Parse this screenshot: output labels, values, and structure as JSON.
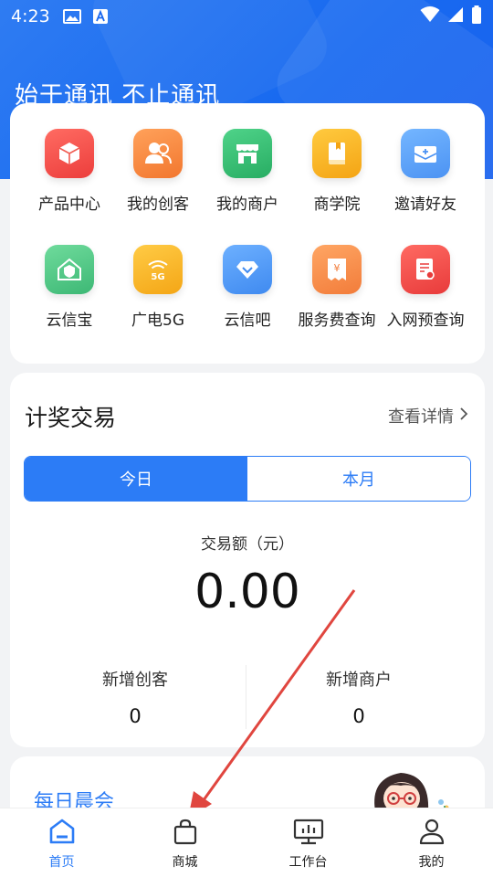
{
  "status_bar": {
    "time": "4:23"
  },
  "hero": {
    "slogan": "始于通讯 不止通讯"
  },
  "quick_menu": {
    "items": [
      {
        "label": "产品中心",
        "icon": "cube-icon",
        "color": "#f2544c"
      },
      {
        "label": "我的创客",
        "icon": "people-icon",
        "color": "#f58a40"
      },
      {
        "label": "我的商户",
        "icon": "store-icon",
        "color": "#35bc75"
      },
      {
        "label": "商学院",
        "icon": "book-icon",
        "color": "#f7b322"
      },
      {
        "label": "邀请好友",
        "icon": "mail-invite-icon",
        "color": "#5aa2f5"
      },
      {
        "label": "云信宝",
        "icon": "house-shield-icon",
        "color": "#54c98a"
      },
      {
        "label": "广电5G",
        "icon": "wifi-5g-icon",
        "color": "#f8b826"
      },
      {
        "label": "云信吧",
        "icon": "diamond-icon",
        "color": "#4a9af4"
      },
      {
        "label": "服务费查询",
        "icon": "receipt-yen-icon",
        "color": "#f78a46"
      },
      {
        "label": "入网预查询",
        "icon": "doc-search-icon",
        "color": "#f04e4e"
      }
    ]
  },
  "reward": {
    "title": "计奖交易",
    "detail_link": "查看详情",
    "tabs": {
      "today": "今日",
      "month": "本月"
    },
    "amount_label": "交易额（元）",
    "amount_value": "0.00",
    "stats": {
      "new_makers_label": "新增创客",
      "new_makers_value": "0",
      "new_merchants_label": "新增商户",
      "new_merchants_value": "0"
    }
  },
  "meeting": {
    "title": "每日晨会"
  },
  "tabbar": {
    "home": "首页",
    "mall": "商城",
    "workbench": "工作台",
    "mine": "我的"
  },
  "colors": {
    "accent": "#2c7cf6",
    "hero": "#1a68ef",
    "arrow": "#e0463f"
  }
}
